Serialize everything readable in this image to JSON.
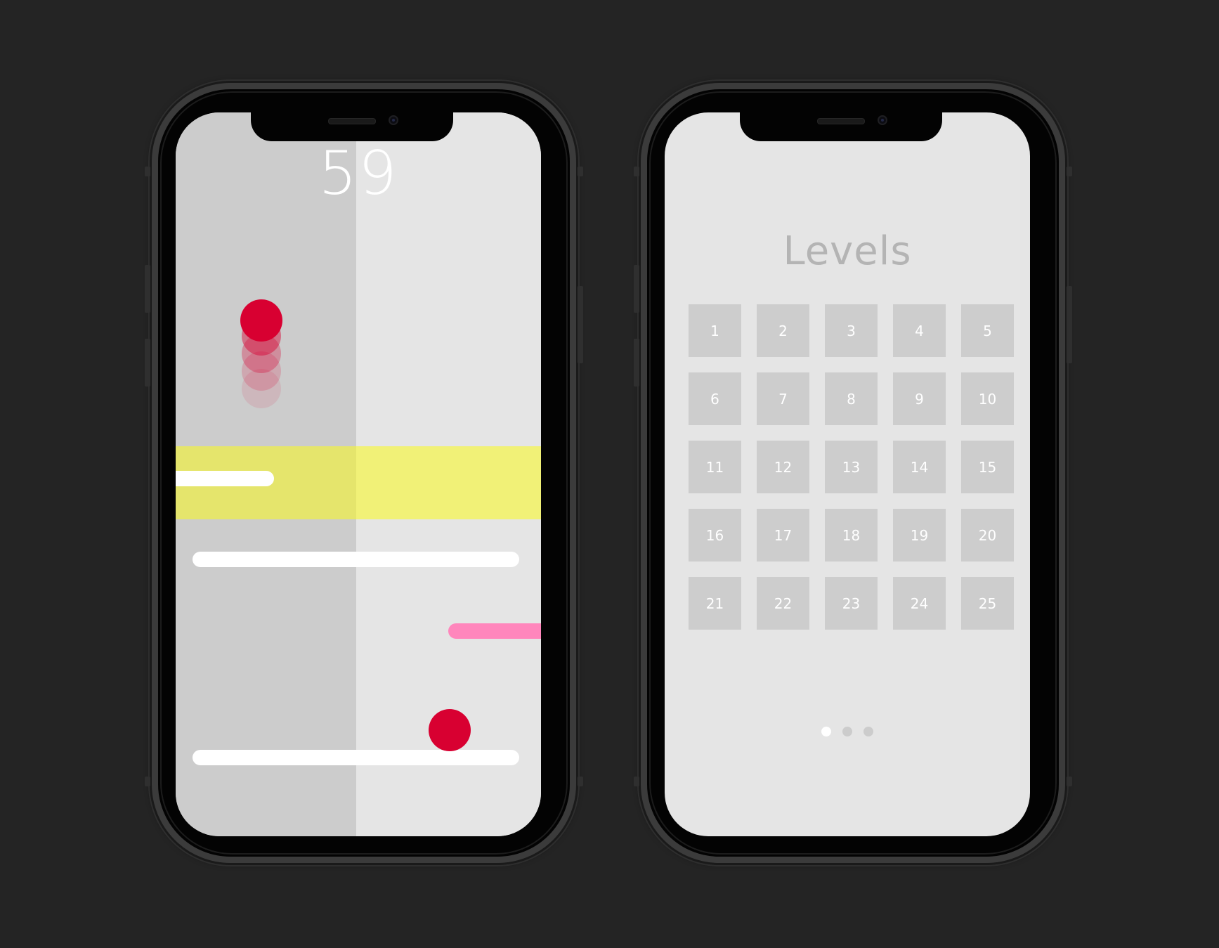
{
  "game": {
    "score": "59",
    "colors": {
      "lane_left": "#cccccc",
      "lane_right": "#e5e5e5",
      "band": "#f1f177",
      "ball": "#d80031",
      "pink_bar": "#ff86bc"
    }
  },
  "levels": {
    "title": "Levels",
    "items": [
      "1",
      "2",
      "3",
      "4",
      "5",
      "6",
      "7",
      "8",
      "9",
      "10",
      "11",
      "12",
      "13",
      "14",
      "15",
      "16",
      "17",
      "18",
      "19",
      "20",
      "21",
      "22",
      "23",
      "24",
      "25"
    ],
    "pages": 3,
    "current_page": 1
  }
}
